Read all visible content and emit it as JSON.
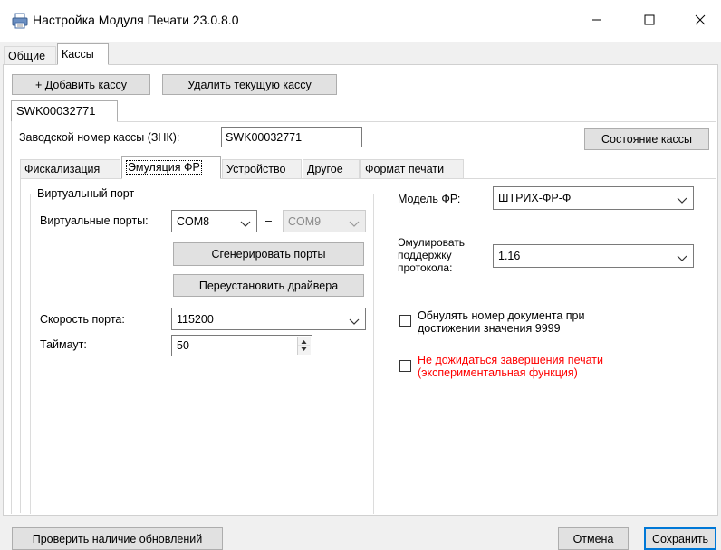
{
  "window": {
    "title": "Настройка Модуля Печати 23.0.8.0",
    "minimize_glyph": "—",
    "maximize_glyph": "☐",
    "close_glyph": "✕",
    "icon": "printer-icon"
  },
  "main_tabs": [
    {
      "label": "Общие",
      "active": false
    },
    {
      "label": "Кассы",
      "active": true
    }
  ],
  "toolbar": {
    "add_label": "+ Добавить кассу",
    "delete_label": "Удалить текущую кассу"
  },
  "register_tab": {
    "label": "SWK00032771"
  },
  "serial": {
    "label": "Заводской номер кассы (ЗНК):",
    "value": "SWK00032771",
    "status_button": "Состояние кассы"
  },
  "sub_tabs": [
    {
      "label": "Фискализация",
      "active": false
    },
    {
      "label": "Эмуляция ФР",
      "active": true
    },
    {
      "label": "Устройство",
      "active": false
    },
    {
      "label": "Другое",
      "active": false
    },
    {
      "label": "Формат печати",
      "active": false
    }
  ],
  "virtual_port": {
    "group_title": "Виртуальный порт",
    "ports_label": "Виртуальные порты:",
    "port1": "COM8",
    "separator": "–",
    "port2": "COM9",
    "generate_button": "Сгенерировать порты",
    "reinstall_button": "Переустановить драйвера"
  },
  "speed": {
    "label": "Скорость порта:",
    "value": "115200"
  },
  "timeout": {
    "label": "Таймаут:",
    "value": "50"
  },
  "model": {
    "label": "Модель ФР:",
    "value": "ШТРИХ-ФР-Ф"
  },
  "protocol": {
    "label": "Эмулировать поддержку протокола:",
    "value": "1.16"
  },
  "checkboxes": {
    "reset_doc_number": {
      "label": "Обнулять номер документа при достижении значения 9999",
      "checked": false
    },
    "no_wait_print": {
      "label": "Не дожидаться завершения печати (экспериментальная функция)",
      "checked": false
    }
  },
  "footer": {
    "check_updates": "Проверить наличие обновлений",
    "cancel": "Отмена",
    "save": "Сохранить"
  },
  "colors": {
    "warning_text": "#ff0000",
    "accent": "#0078d7"
  }
}
